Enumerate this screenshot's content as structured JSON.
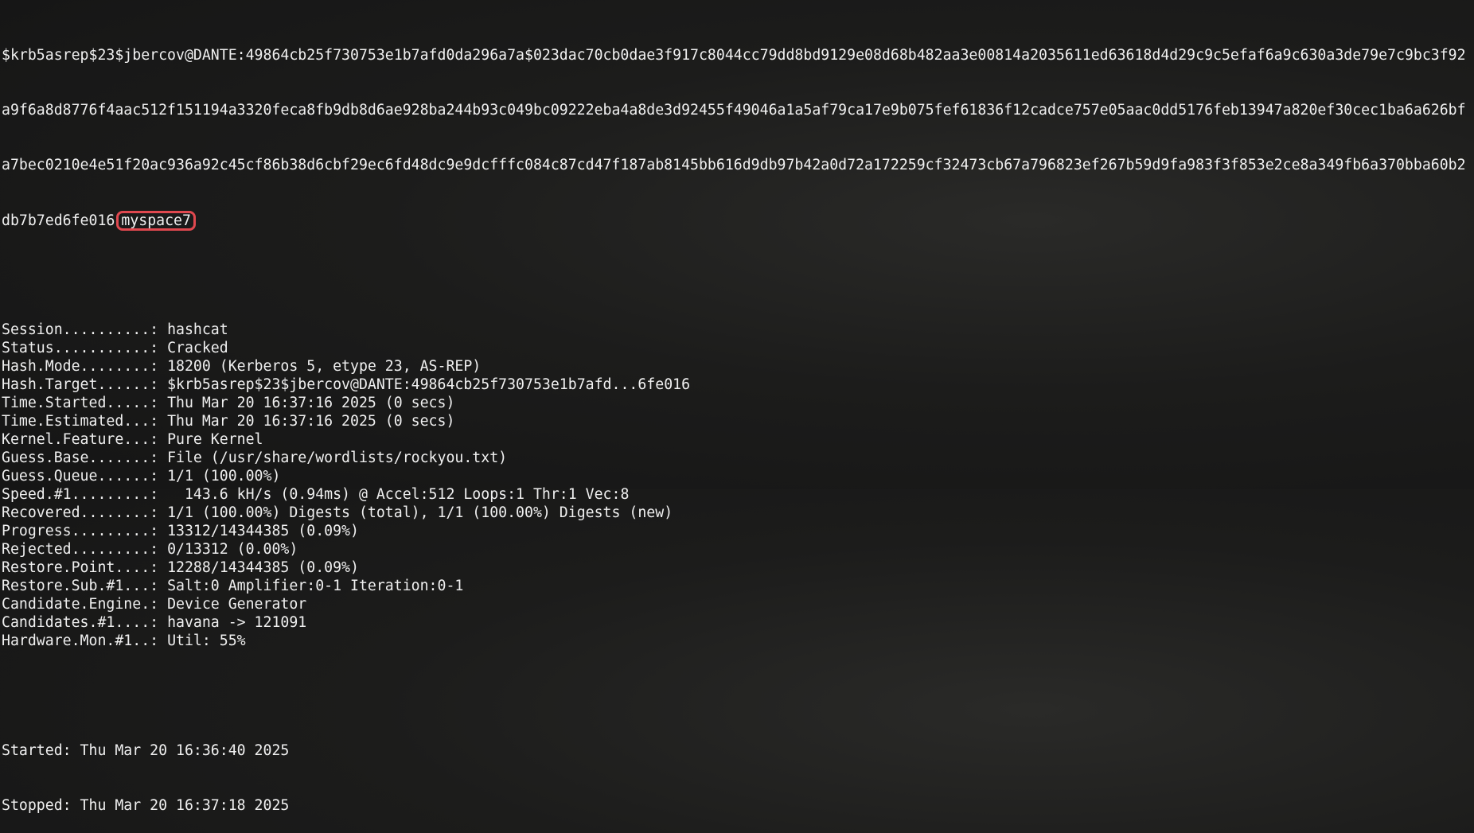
{
  "hash_output": {
    "line1": "$krb5asrep$23$jbercov@DANTE:49864cb25f730753e1b7afd0da296a7a$023dac70cb0dae3f917c8044cc79dd8bd9129e08d68b482aa3e00814a2035611ed63618d4d29c9c5efaf6a9c630a3de79e7c9bc3f92",
    "line2": "a9f6a8d8776f4aac512f151194a3320feca8fb9db8d6ae928ba244b93c049bc09222eba4a8de3d92455f49046a1a5af79ca17e9b075fef61836f12cadce757e05aac0dd5176feb13947a820ef30cec1ba6a626bf",
    "line3": "a7bec0210e4e51f20ac936a92c45cf86b38d6cbf29ec6fd48dc9e9dcfffc084c87cd47f187ab8145bb616d9db97b42a0d72a172259cf32473cb67a796823ef267b59d9fa983f3f853e2ce8a349fb6a370bba60b2",
    "line4_prefix": "db7b7ed6fe016",
    "cracked_password": "myspace7"
  },
  "status_lines": [
    {
      "label": "Session..........:",
      "value": "hashcat"
    },
    {
      "label": "Status...........:",
      "value": "Cracked"
    },
    {
      "label": "Hash.Mode........:",
      "value": "18200 (Kerberos 5, etype 23, AS-REP)"
    },
    {
      "label": "Hash.Target......:",
      "value": "$krb5asrep$23$jbercov@DANTE:49864cb25f730753e1b7afd...6fe016"
    },
    {
      "label": "Time.Started.....:",
      "value": "Thu Mar 20 16:37:16 2025 (0 secs)"
    },
    {
      "label": "Time.Estimated...:",
      "value": "Thu Mar 20 16:37:16 2025 (0 secs)"
    },
    {
      "label": "Kernel.Feature...:",
      "value": "Pure Kernel"
    },
    {
      "label": "Guess.Base.......:",
      "value": "File (/usr/share/wordlists/rockyou.txt)"
    },
    {
      "label": "Guess.Queue......:",
      "value": "1/1 (100.00%)"
    },
    {
      "label": "Speed.#1.........:",
      "value": "  143.6 kH/s (0.94ms) @ Accel:512 Loops:1 Thr:1 Vec:8"
    },
    {
      "label": "Recovered........:",
      "value": "1/1 (100.00%) Digests (total), 1/1 (100.00%) Digests (new)"
    },
    {
      "label": "Progress.........:",
      "value": "13312/14344385 (0.09%)"
    },
    {
      "label": "Rejected.........:",
      "value": "0/13312 (0.00%)"
    },
    {
      "label": "Restore.Point....:",
      "value": "12288/14344385 (0.09%)"
    },
    {
      "label": "Restore.Sub.#1...:",
      "value": "Salt:0 Amplifier:0-1 Iteration:0-1"
    },
    {
      "label": "Candidate.Engine.:",
      "value": "Device Generator"
    },
    {
      "label": "Candidates.#1....:",
      "value": "havana -> 121091"
    },
    {
      "label": "Hardware.Mon.#1..:",
      "value": "Util: 55%"
    }
  ],
  "footer": {
    "started": "Started: Thu Mar 20 16:36:40 2025",
    "stopped": "Stopped: Thu Mar 20 16:37:18 2025"
  },
  "colors": {
    "text": "#f0f0f0",
    "highlight_border": "#e0484f",
    "background": "#1c1c1b"
  }
}
